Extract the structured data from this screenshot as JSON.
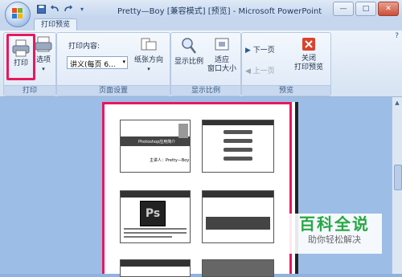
{
  "window": {
    "title": "Pretty—Boy [兼容模式] [预览] - Microsoft PowerPoint",
    "controls": [
      "—",
      "□",
      "✕"
    ]
  },
  "tabs": [
    {
      "label": "打印预览"
    }
  ],
  "ribbon": {
    "groups": [
      {
        "label": "打印",
        "buttons": [
          {
            "label": "打印"
          },
          {
            "label": "选项"
          }
        ]
      },
      {
        "label": "页面设置",
        "print_content_label": "打印内容:",
        "print_content_value": "讲义(每页 6...",
        "orientation_label_1": "纸张方向"
      },
      {
        "label": "显示比例",
        "buttons": [
          {
            "label": "显示比例"
          },
          {
            "label_1": "适应",
            "label_2": "窗口大小"
          }
        ]
      },
      {
        "label": "预览",
        "next": "下一页",
        "prev": "上一页",
        "close_1": "关闭",
        "close_2": "打印预览"
      }
    ]
  },
  "slides": [
    {
      "title": "Photoshop应用简介",
      "author": "主讲人：Pretty—Boy"
    },
    {
      "logo": "Ps"
    }
  ],
  "watermark": {
    "big": "百科全说",
    "small": "助你轻松解决"
  },
  "colors": {
    "highlight": "#e8185e",
    "ribbon": "#d6e3f3",
    "workspace": "#9cbde6"
  }
}
